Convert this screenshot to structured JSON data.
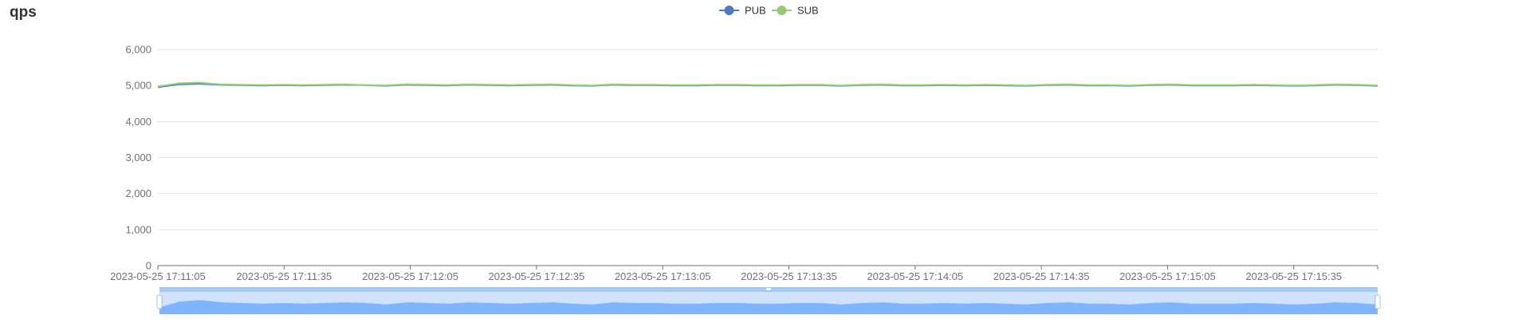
{
  "panel": {
    "title": "qps"
  },
  "chart_data": {
    "type": "line",
    "title": "qps",
    "xlabel": "",
    "ylabel": "",
    "ylim": [
      0,
      6000
    ],
    "yticks": [
      0,
      1000,
      2000,
      3000,
      4000,
      5000,
      6000
    ],
    "ytick_labels": [
      "0",
      "1,000",
      "2,000",
      "3,000",
      "4,000",
      "5,000",
      "6,000"
    ],
    "x_start": "2023-05-25 17:11:05",
    "x_end": "2023-05-25 17:15:55",
    "xtick_labels": [
      "2023-05-25 17:11:05",
      "2023-05-25 17:11:35",
      "2023-05-25 17:12:05",
      "2023-05-25 17:12:35",
      "2023-05-25 17:13:05",
      "2023-05-25 17:13:35",
      "2023-05-25 17:14:05",
      "2023-05-25 17:14:35",
      "2023-05-25 17:15:05",
      "2023-05-25 17:15:35"
    ],
    "grid": true,
    "legend_position": "top-center",
    "series": [
      {
        "name": "PUB",
        "color": "#4a7bcb",
        "values": [
          4950,
          5030,
          5050,
          5020,
          5010,
          5000,
          5010,
          5000,
          5010,
          5020,
          5010,
          4990,
          5020,
          5010,
          5000,
          5020,
          5010,
          5000,
          5010,
          5020,
          5000,
          4990,
          5020,
          5010,
          5010,
          5000,
          5000,
          5010,
          5010,
          5000,
          5000,
          5010,
          5010,
          4990,
          5010,
          5020,
          5000,
          5000,
          5010,
          5000,
          5010,
          5000,
          4990,
          5010,
          5020,
          5000,
          5000,
          4990,
          5010,
          5020,
          5000,
          5000,
          5000,
          5010,
          5000,
          4990,
          5000,
          5020,
          5010,
          4990
        ]
      },
      {
        "name": "SUB",
        "color": "#91cc75",
        "values": [
          4970,
          5060,
          5080,
          5030,
          5020,
          5010,
          5020,
          5010,
          5020,
          5030,
          5010,
          5000,
          5030,
          5020,
          5010,
          5030,
          5020,
          5010,
          5020,
          5030,
          5010,
          5000,
          5030,
          5020,
          5020,
          5010,
          5010,
          5020,
          5020,
          5010,
          5010,
          5020,
          5020,
          5000,
          5020,
          5030,
          5010,
          5010,
          5020,
          5010,
          5020,
          5010,
          5000,
          5020,
          5030,
          5010,
          5010,
          5000,
          5020,
          5030,
          5010,
          5010,
          5010,
          5020,
          5010,
          5000,
          5010,
          5030,
          5020,
          5000
        ]
      }
    ]
  },
  "colors": {
    "pub": "#4a7bcb",
    "sub": "#91cc75",
    "grid": "#e0e3ea",
    "axis": "#6e7079",
    "zoom_fill": "#7fb4ff",
    "zoom_bg": "#cfe1fb"
  }
}
